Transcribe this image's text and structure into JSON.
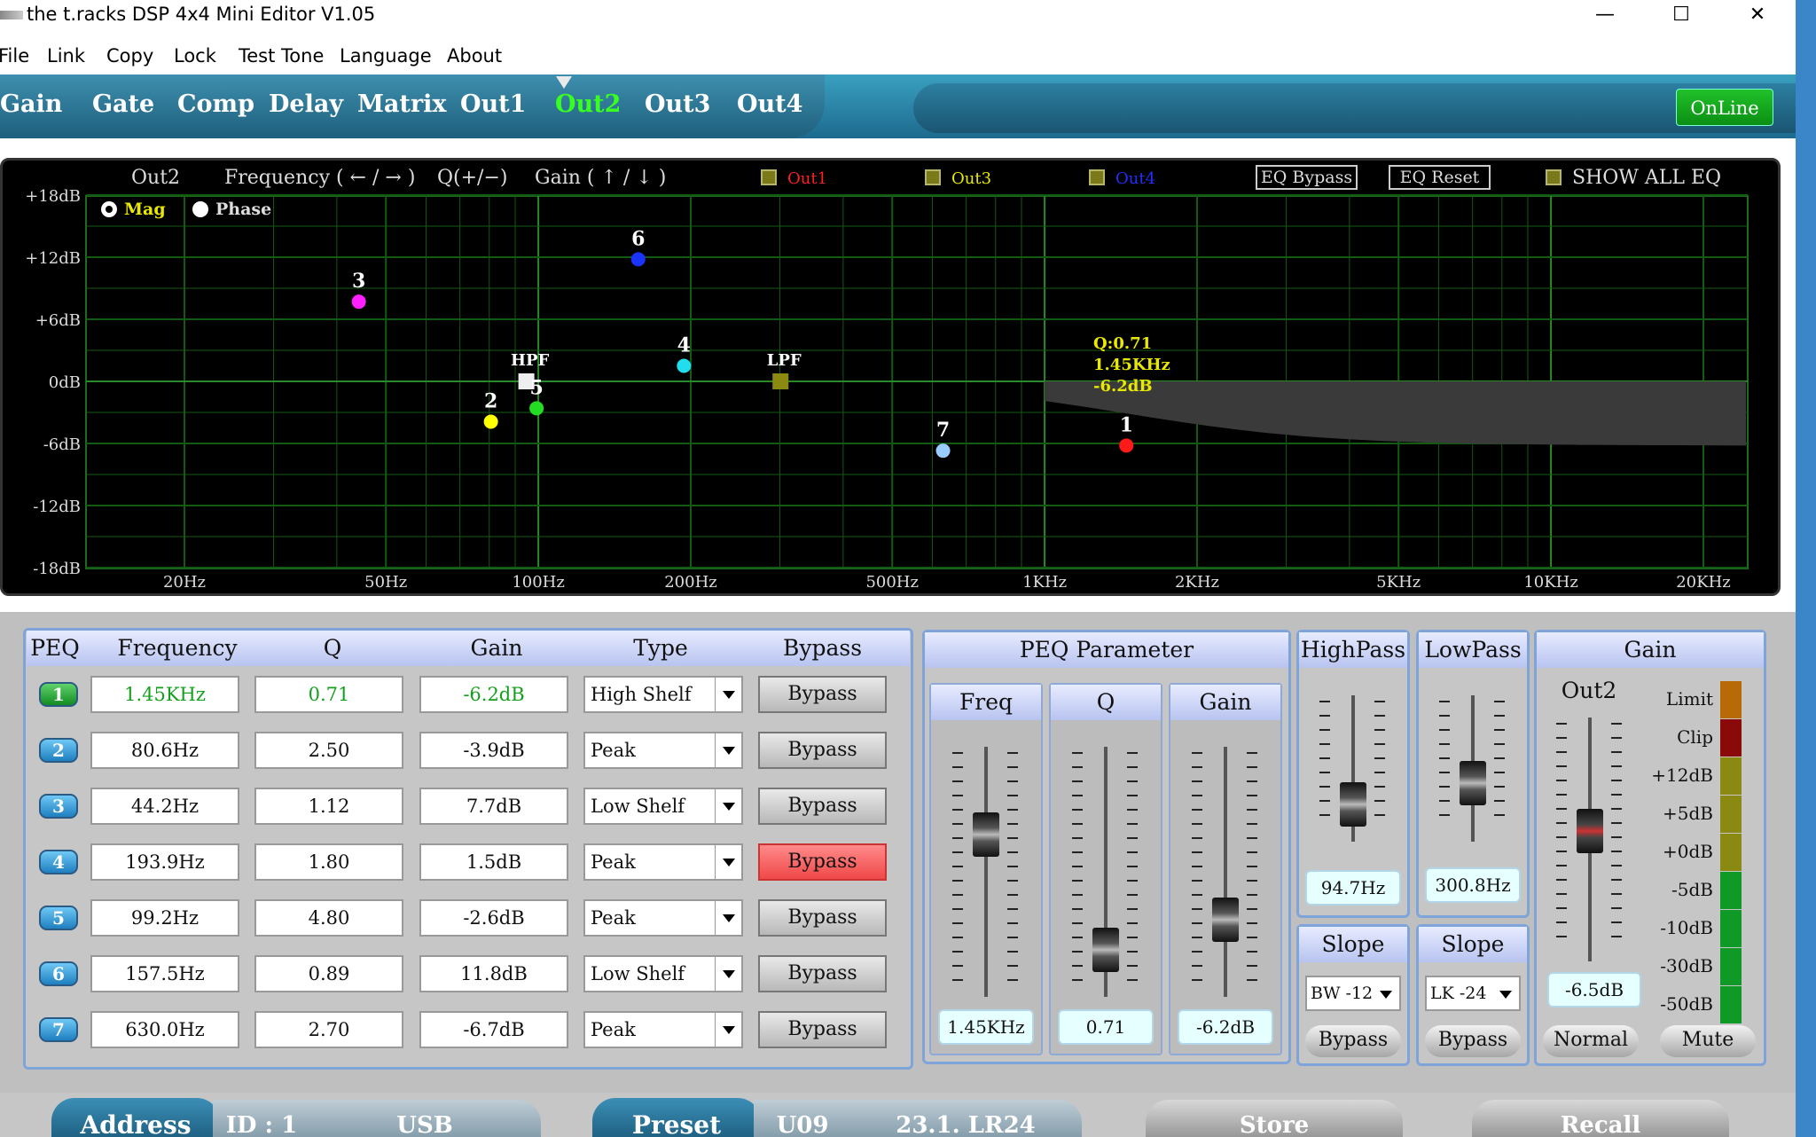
{
  "window": {
    "title": "the t.racks DSP 4x4 Mini Editor V1.05",
    "min": "—",
    "max": "☐",
    "close": "✕"
  },
  "menu": [
    "File",
    "Link",
    "Copy",
    "Lock",
    "Test Tone",
    "Language",
    "About"
  ],
  "tabs": [
    "Gain",
    "Gate",
    "Comp",
    "Delay",
    "Matrix",
    "Out1",
    "Out2",
    "Out3",
    "Out4"
  ],
  "active_tab": "Out2",
  "online_label": "OnLine",
  "graph": {
    "channel": "Out2",
    "freq_hint": "Frequency ( ← / → )",
    "q_hint": "Q(+/−)",
    "gain_hint": "Gain ( ↑ / ↓ )",
    "channels": [
      {
        "label": "Out1",
        "color": "#ff2020"
      },
      {
        "label": "Out3",
        "color": "#e8e800"
      },
      {
        "label": "Out4",
        "color": "#2030ff"
      }
    ],
    "eq_bypass": "EQ Bypass",
    "eq_reset": "EQ Reset",
    "show_all": "SHOW ALL EQ",
    "mag_label": "Mag",
    "phase_label": "Phase",
    "y_ticks": [
      "+18dB",
      "+12dB",
      "+6dB",
      "0dB",
      "-6dB",
      "-12dB",
      "-18dB"
    ],
    "x_ticks": [
      "20Hz",
      "50Hz",
      "100Hz",
      "200Hz",
      "500Hz",
      "1KHz",
      "2KHz",
      "5KHz",
      "10KHz",
      "20KHz"
    ],
    "tooltip": [
      "Q:0.71",
      "1.45KHz",
      "-6.2dB"
    ],
    "hpf_label": "HPF",
    "lpf_label": "LPF",
    "points": [
      {
        "label": "1",
        "color": "#ff1a1a",
        "freq": 1450,
        "gain": -6.2
      },
      {
        "label": "2",
        "color": "#ffff00",
        "freq": 80.6,
        "gain": -3.9
      },
      {
        "label": "3",
        "color": "#ff20ff",
        "freq": 44.2,
        "gain": 7.7
      },
      {
        "label": "4",
        "color": "#22ddee",
        "freq": 193.9,
        "gain": 1.5
      },
      {
        "label": "5",
        "color": "#22dd22",
        "freq": 99.2,
        "gain": -2.6
      },
      {
        "label": "6",
        "color": "#1a33ff",
        "freq": 157.5,
        "gain": 11.8
      },
      {
        "label": "7",
        "color": "#99ccff",
        "freq": 630.0,
        "gain": -6.7
      }
    ],
    "hpf": {
      "freq": 94.7
    },
    "lpf": {
      "freq": 300.8
    }
  },
  "peq_table": {
    "headers": [
      "PEQ",
      "Frequency",
      "Q",
      "Gain",
      "Type",
      "Bypass"
    ],
    "rows": [
      {
        "num": "1",
        "freq": "1.45KHz",
        "q": "0.71",
        "gain": "-6.2dB",
        "type": "High Shelf",
        "bypass": "Bypass",
        "bypass_on": false,
        "selected": true
      },
      {
        "num": "2",
        "freq": "80.6Hz",
        "q": "2.50",
        "gain": "-3.9dB",
        "type": "Peak",
        "bypass": "Bypass",
        "bypass_on": false,
        "selected": false
      },
      {
        "num": "3",
        "freq": "44.2Hz",
        "q": "1.12",
        "gain": "7.7dB",
        "type": "Low Shelf",
        "bypass": "Bypass",
        "bypass_on": false,
        "selected": false
      },
      {
        "num": "4",
        "freq": "193.9Hz",
        "q": "1.80",
        "gain": "1.5dB",
        "type": "Peak",
        "bypass": "Bypass",
        "bypass_on": true,
        "selected": false
      },
      {
        "num": "5",
        "freq": "99.2Hz",
        "q": "4.80",
        "gain": "-2.6dB",
        "type": "Peak",
        "bypass": "Bypass",
        "bypass_on": false,
        "selected": false
      },
      {
        "num": "6",
        "freq": "157.5Hz",
        "q": "0.89",
        "gain": "11.8dB",
        "type": "Low Shelf",
        "bypass": "Bypass",
        "bypass_on": false,
        "selected": false
      },
      {
        "num": "7",
        "freq": "630.0Hz",
        "q": "2.70",
        "gain": "-6.7dB",
        "type": "Peak",
        "bypass": "Bypass",
        "bypass_on": false,
        "selected": false
      }
    ]
  },
  "peq_param": {
    "title": "PEQ Parameter",
    "freq_label": "Freq",
    "q_label": "Q",
    "gain_label": "Gain",
    "freq_value": "1.45KHz",
    "q_value": "0.71",
    "gain_value": "-6.2dB"
  },
  "highpass": {
    "title": "HighPass",
    "value": "94.7Hz",
    "slope_title": "Slope",
    "slope": "BW -12",
    "bypass": "Bypass"
  },
  "lowpass": {
    "title": "LowPass",
    "value": "300.8Hz",
    "slope_title": "Slope",
    "slope": "LK -24",
    "bypass": "Bypass"
  },
  "gain_panel": {
    "title": "Gain",
    "channel": "Out2",
    "value": "-6.5dB",
    "normal": "Normal",
    "mute": "Mute",
    "meter_labels": [
      "Limit",
      "Clip",
      "+12dB",
      "+5dB",
      "+0dB",
      "-5dB",
      "-10dB",
      "-30dB",
      "-50dB"
    ]
  },
  "status": {
    "address": "Address",
    "id": "ID : 1",
    "usb": "USB",
    "preset": "Preset",
    "preset_slot": "U09",
    "preset_name": "23.1. LR24",
    "store": "Store",
    "recall": "Recall"
  }
}
